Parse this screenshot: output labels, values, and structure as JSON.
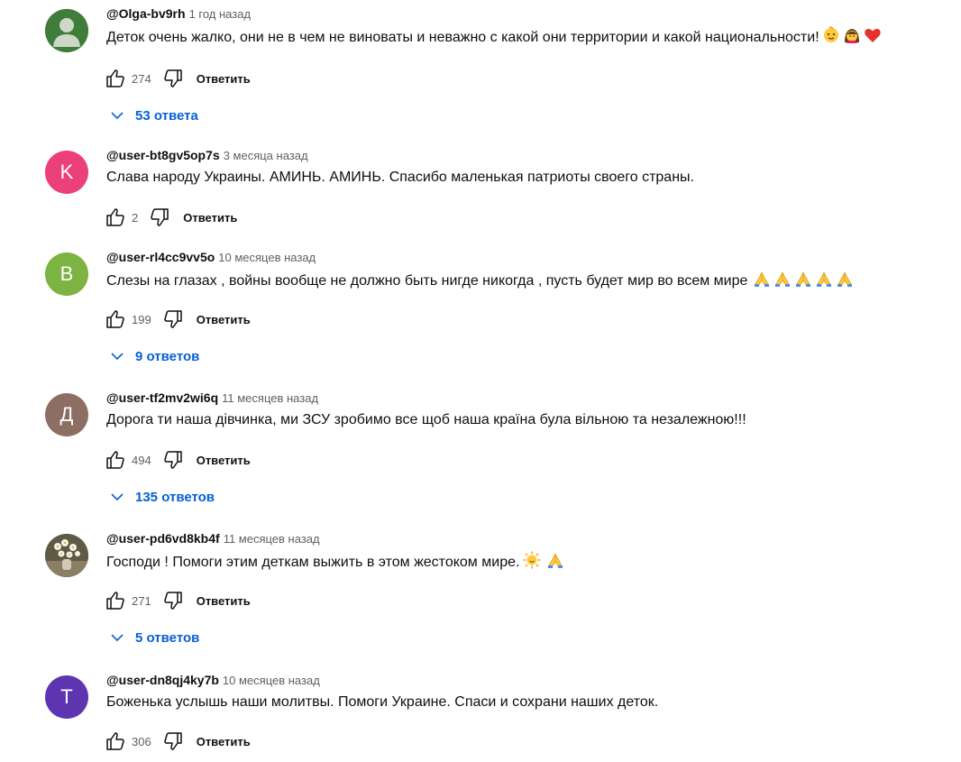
{
  "comments": [
    {
      "author": "@Olga-bv9rh",
      "time": "1 год назад",
      "text": "Деток очень жалко, они не в чем не виноваты и неважно с какой они  территории и какой национальности!",
      "likes": "274",
      "reply_label": "Ответить",
      "replies_label": "53 ответа",
      "avatar_letter": "",
      "avatar_color": "#3f7d3a",
      "emojis": [
        "baby",
        "girl",
        "red-heart"
      ]
    },
    {
      "author": "@user-bt8gv5op7s",
      "time": "3 месяца назад",
      "text": "Слава народу Украины. АМИНЬ. АМИНЬ. Спасибо маленькая патриоты своего страны.",
      "likes": "2",
      "reply_label": "Ответить",
      "replies_label": "",
      "avatar_letter": "K",
      "avatar_color": "#ec407a",
      "emojis": []
    },
    {
      "author": "@user-rl4cc9vv5o",
      "time": "10 месяцев назад",
      "text": "Слезы на глазах , войны вообще не должно быть нигде никогда , пусть будет мир во всем мире",
      "likes": "199",
      "reply_label": "Ответить",
      "replies_label": "9 ответов",
      "avatar_letter": "B",
      "avatar_color": "#7cb342",
      "emojis": [
        "folded-hands",
        "folded-hands",
        "folded-hands",
        "folded-hands",
        "folded-hands"
      ]
    },
    {
      "author": "@user-tf2mv2wi6q",
      "time": "11 месяцев назад",
      "text": "Дорога ти наша дівчинка, ми ЗСУ зробимо все щоб наша країна була вільною та незалежною!!!",
      "likes": "494",
      "reply_label": "Ответить",
      "replies_label": "135 ответов",
      "avatar_letter": "Д",
      "avatar_color": "#8d6e63",
      "emojis": []
    },
    {
      "author": "@user-pd6vd8kb4f",
      "time": "11 месяцев назад",
      "text": "Господи ! Помоги этим деткам выжить в этом жестоком мире.",
      "likes": "271",
      "reply_label": "Ответить",
      "replies_label": "5 ответов",
      "avatar_letter": "",
      "avatar_color": "#6b6a4e",
      "emojis": [
        "sun-face",
        "folded-hands"
      ]
    },
    {
      "author": "@user-dn8qj4ky7b",
      "time": "10 месяцев назад",
      "text": "Боженька услышь наши молитвы. Помоги Украине. Спаси и сохрани наших деток.",
      "likes": "306",
      "reply_label": "Ответить",
      "replies_label": "",
      "avatar_letter": "T",
      "avatar_color": "#5e35b1",
      "emojis": []
    }
  ]
}
